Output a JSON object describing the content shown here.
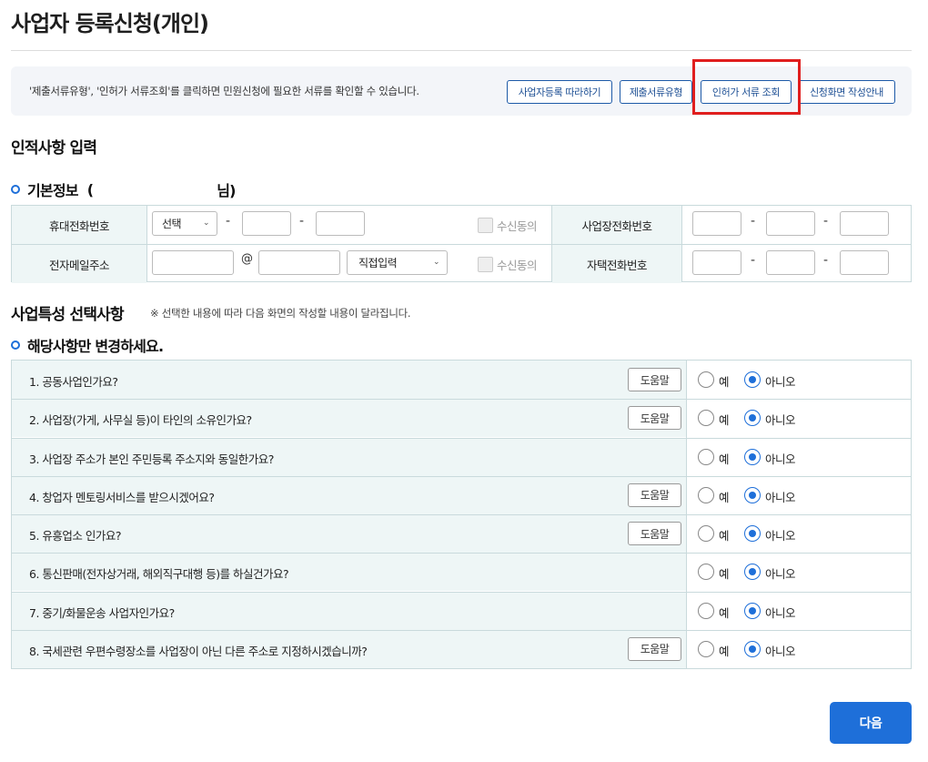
{
  "page": {
    "title": "사업자 등록신청(개인)"
  },
  "info": {
    "text": "'제출서류유형', '인허가 서류조회'를 클릭하면 민원신청에 필요한 서류를 확인할 수 있습니다.",
    "buttons": [
      "사업자등록 따라하기",
      "제출서류유형",
      "인허가 서류 조회",
      "신청화면 작성안내"
    ]
  },
  "personal": {
    "title": "인적사항 입력"
  },
  "basic": {
    "title": "기본정보",
    "open_paren": "(",
    "suffix": "님)",
    "mobile_label": "휴대전화번호",
    "mobile_select": "선택",
    "email_label": "전자메일주소",
    "email_at": "@",
    "email_domain_select": "직접입력",
    "consent_label": "수신동의",
    "dash": "-",
    "biz_phone_label": "사업장전화번호",
    "home_phone_label": "자택전화번호"
  },
  "features": {
    "title": "사업특성 선택사항",
    "note": "※ 선택한 내용에 따라 다음 화면의 작성할 내용이 달라집니다.",
    "subtitle": "해당사항만 변경하세요.",
    "help_label": "도움말",
    "yes_label": "예",
    "no_label": "아니오",
    "questions": [
      {
        "text": "1. 공동사업인가요?",
        "help": true,
        "answer": "no"
      },
      {
        "text": "2. 사업장(가게, 사무실 등)이 타인의 소유인가요?",
        "help": true,
        "answer": "no"
      },
      {
        "text": "3. 사업장 주소가 본인 주민등록 주소지와 동일한가요?",
        "help": false,
        "answer": "no"
      },
      {
        "text": "4. 창업자 멘토링서비스를 받으시겠어요?",
        "help": true,
        "answer": "no"
      },
      {
        "text": "5. 유흥업소 인가요?",
        "help": true,
        "answer": "no"
      },
      {
        "text": "6. 통신판매(전자상거래, 해외직구대행 등)를 하실건가요?",
        "help": false,
        "answer": "no"
      },
      {
        "text": "7. 중기/화물운송 사업자인가요?",
        "help": false,
        "answer": "no"
      },
      {
        "text": "8. 국세관련 우편수령장소를 사업장이 아닌 다른 주소로 지정하시겠습니까?",
        "help": true,
        "answer": "no"
      }
    ]
  },
  "next_button": "다음",
  "colors": {
    "accent": "#1e6fd9",
    "highlight": "#e01e1e",
    "label_bg": "#eef6f6"
  }
}
